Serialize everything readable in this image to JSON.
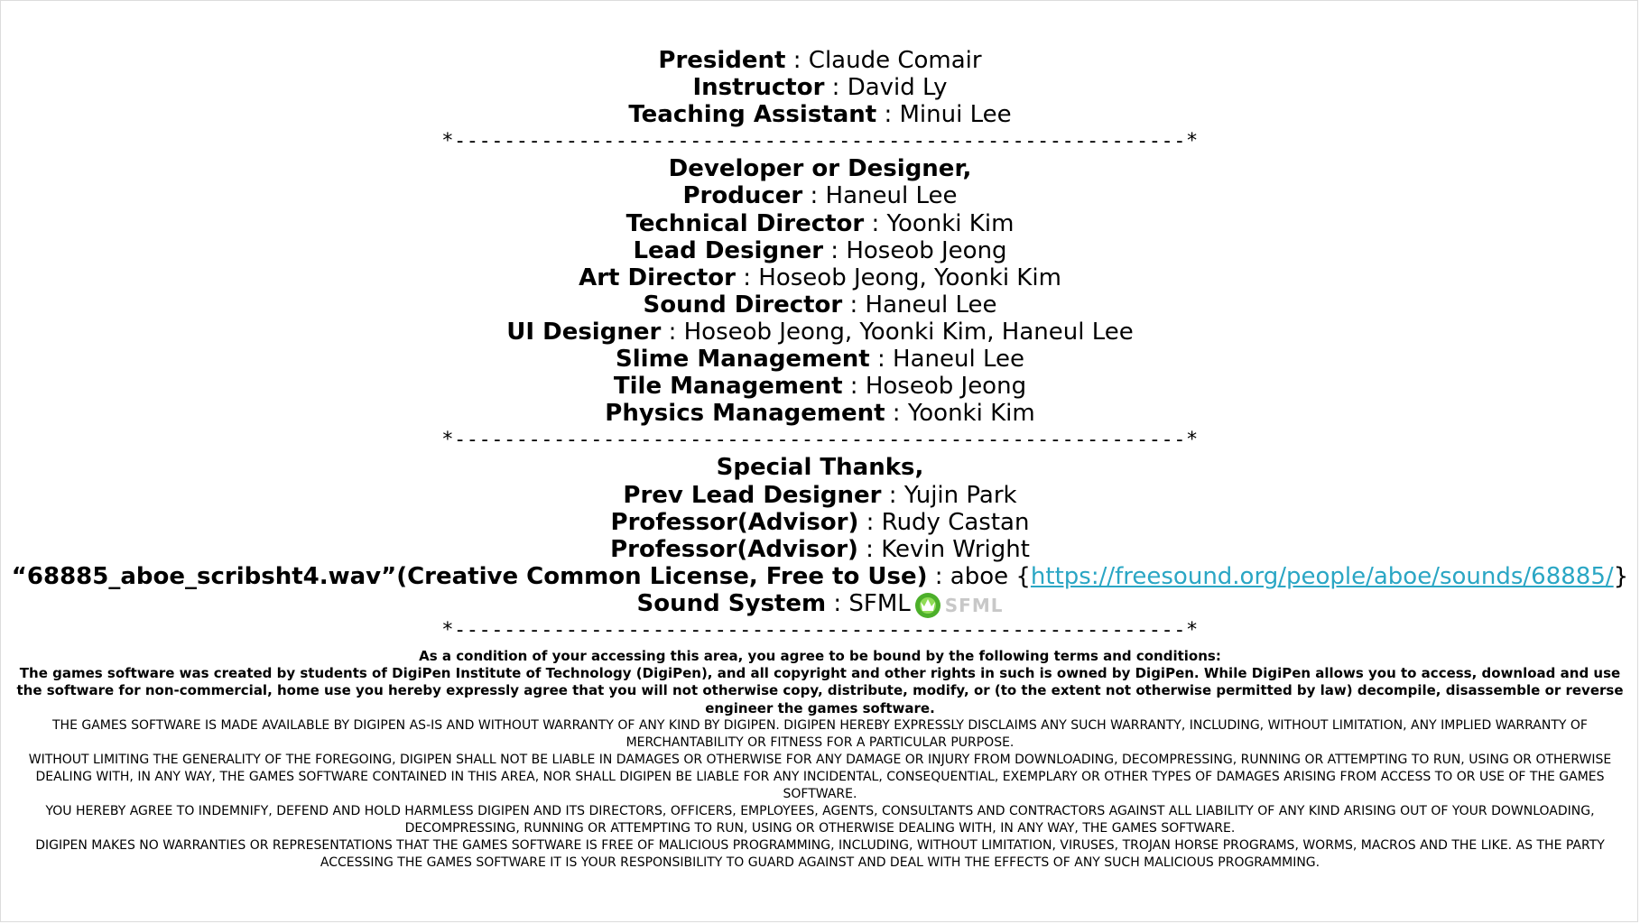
{
  "leadership": [
    {
      "role": "President",
      "name": "Claude Comair"
    },
    {
      "role": "Instructor",
      "name": "David Ly"
    },
    {
      "role": "Teaching Assistant",
      "name": "Minui Lee"
    }
  ],
  "separator": "*-----------------------------------------------------------*",
  "developers": {
    "heading": "Developer or Designer,",
    "roles": [
      {
        "role": "Producer",
        "name": "Haneul Lee"
      },
      {
        "role": "Technical Director",
        "name": "Yoonki Kim"
      },
      {
        "role": "Lead Designer",
        "name": "Hoseob Jeong"
      },
      {
        "role": "Art Director",
        "name": "Hoseob Jeong, Yoonki Kim"
      },
      {
        "role": "Sound Director",
        "name": "Haneul Lee"
      },
      {
        "role": "UI Designer",
        "name": "Hoseob Jeong, Yoonki Kim, Haneul Lee"
      },
      {
        "role": "Slime Management",
        "name": "Haneul Lee"
      },
      {
        "role": "Tile Management",
        "name": "Hoseob Jeong"
      },
      {
        "role": "Physics Management",
        "name": "Yoonki Kim"
      }
    ]
  },
  "special_thanks": {
    "heading": "Special Thanks,",
    "roles": [
      {
        "role": "Prev Lead Designer",
        "name": "Yujin Park"
      },
      {
        "role": "Professor(Advisor)",
        "name": "Rudy Castan"
      },
      {
        "role": "Professor(Advisor)",
        "name": "Kevin Wright"
      }
    ],
    "sound_credit": {
      "role": "“68885_aboe_scribsht4.wav”(Creative Common License, Free to Use)",
      "name": "aboe",
      "open_brace": "{",
      "link": "https://freesound.org/people/aboe/sounds/68885/",
      "close_brace": "}"
    },
    "sound_system": {
      "role": "Sound System",
      "name": "SFML",
      "logo_text": "SFML"
    }
  },
  "colon": " : ",
  "terms": {
    "intro": "As a condition of your accessing this area, you agree to be bound by the following terms and conditions:",
    "p1": "The games software was created by students of DigiPen Institute of Technology (DigiPen), and all copyright and other rights in such is owned by DigiPen. While DigiPen allows you to access, download and use the software for non-commercial, home use you hereby expressly agree that you will not otherwise copy, distribute, modify, or (to the extent not otherwise permitted by law) decompile, disassemble or reverse engineer the games software.",
    "p2": "THE GAMES SOFTWARE IS MADE AVAILABLE BY DIGIPEN AS-IS AND WITHOUT WARRANTY OF ANY KIND BY DIGIPEN. DIGIPEN HEREBY EXPRESSLY DISCLAIMS ANY SUCH WARRANTY, INCLUDING, WITHOUT LIMITATION, ANY IMPLIED WARRANTY OF MERCHANTABILITY OR FITNESS FOR A PARTICULAR PURPOSE.",
    "p3": "WITHOUT LIMITING THE GENERALITY OF THE FOREGOING, DIGIPEN SHALL NOT BE LIABLE IN DAMAGES OR OTHERWISE FOR ANY DAMAGE OR INJURY FROM DOWNLOADING, DECOMPRESSING, RUNNING OR ATTEMPTING TO RUN, USING OR OTHERWISE DEALING WITH, IN ANY WAY, THE GAMES SOFTWARE CONTAINED IN THIS AREA, NOR SHALL DIGIPEN BE LIABLE FOR ANY INCIDENTAL, CONSEQUENTIAL, EXEMPLARY OR OTHER TYPES OF DAMAGES ARISING FROM ACCESS TO OR USE OF THE GAMES SOFTWARE.",
    "p4": "YOU HEREBY AGREE TO INDEMNIFY, DEFEND AND HOLD HARMLESS DIGIPEN AND ITS DIRECTORS, OFFICERS, EMPLOYEES, AGENTS, CONSULTANTS AND CONTRACTORS AGAINST ALL LIABILITY OF ANY KIND ARISING OUT OF YOUR DOWNLOADING, DECOMPRESSING, RUNNING OR ATTEMPTING TO RUN, USING OR OTHERWISE DEALING WITH, IN ANY WAY, THE GAMES SOFTWARE.",
    "p5": "DIGIPEN MAKES NO WARRANTIES OR REPRESENTATIONS THAT THE GAMES SOFTWARE IS FREE OF MALICIOUS PROGRAMMING, INCLUDING, WITHOUT LIMITATION, VIRUSES, TROJAN HORSE PROGRAMS, WORMS, MACROS AND THE LIKE. AS THE PARTY ACCESSING THE GAMES SOFTWARE IT IS YOUR RESPONSIBILITY TO GUARD AGAINST AND DEAL WITH THE EFFECTS OF ANY SUCH MALICIOUS PROGRAMMING."
  },
  "colors": {
    "link": "#2aa6c4",
    "logo_green": "#4caf2a",
    "logo_grey": "#c8c8c8"
  }
}
